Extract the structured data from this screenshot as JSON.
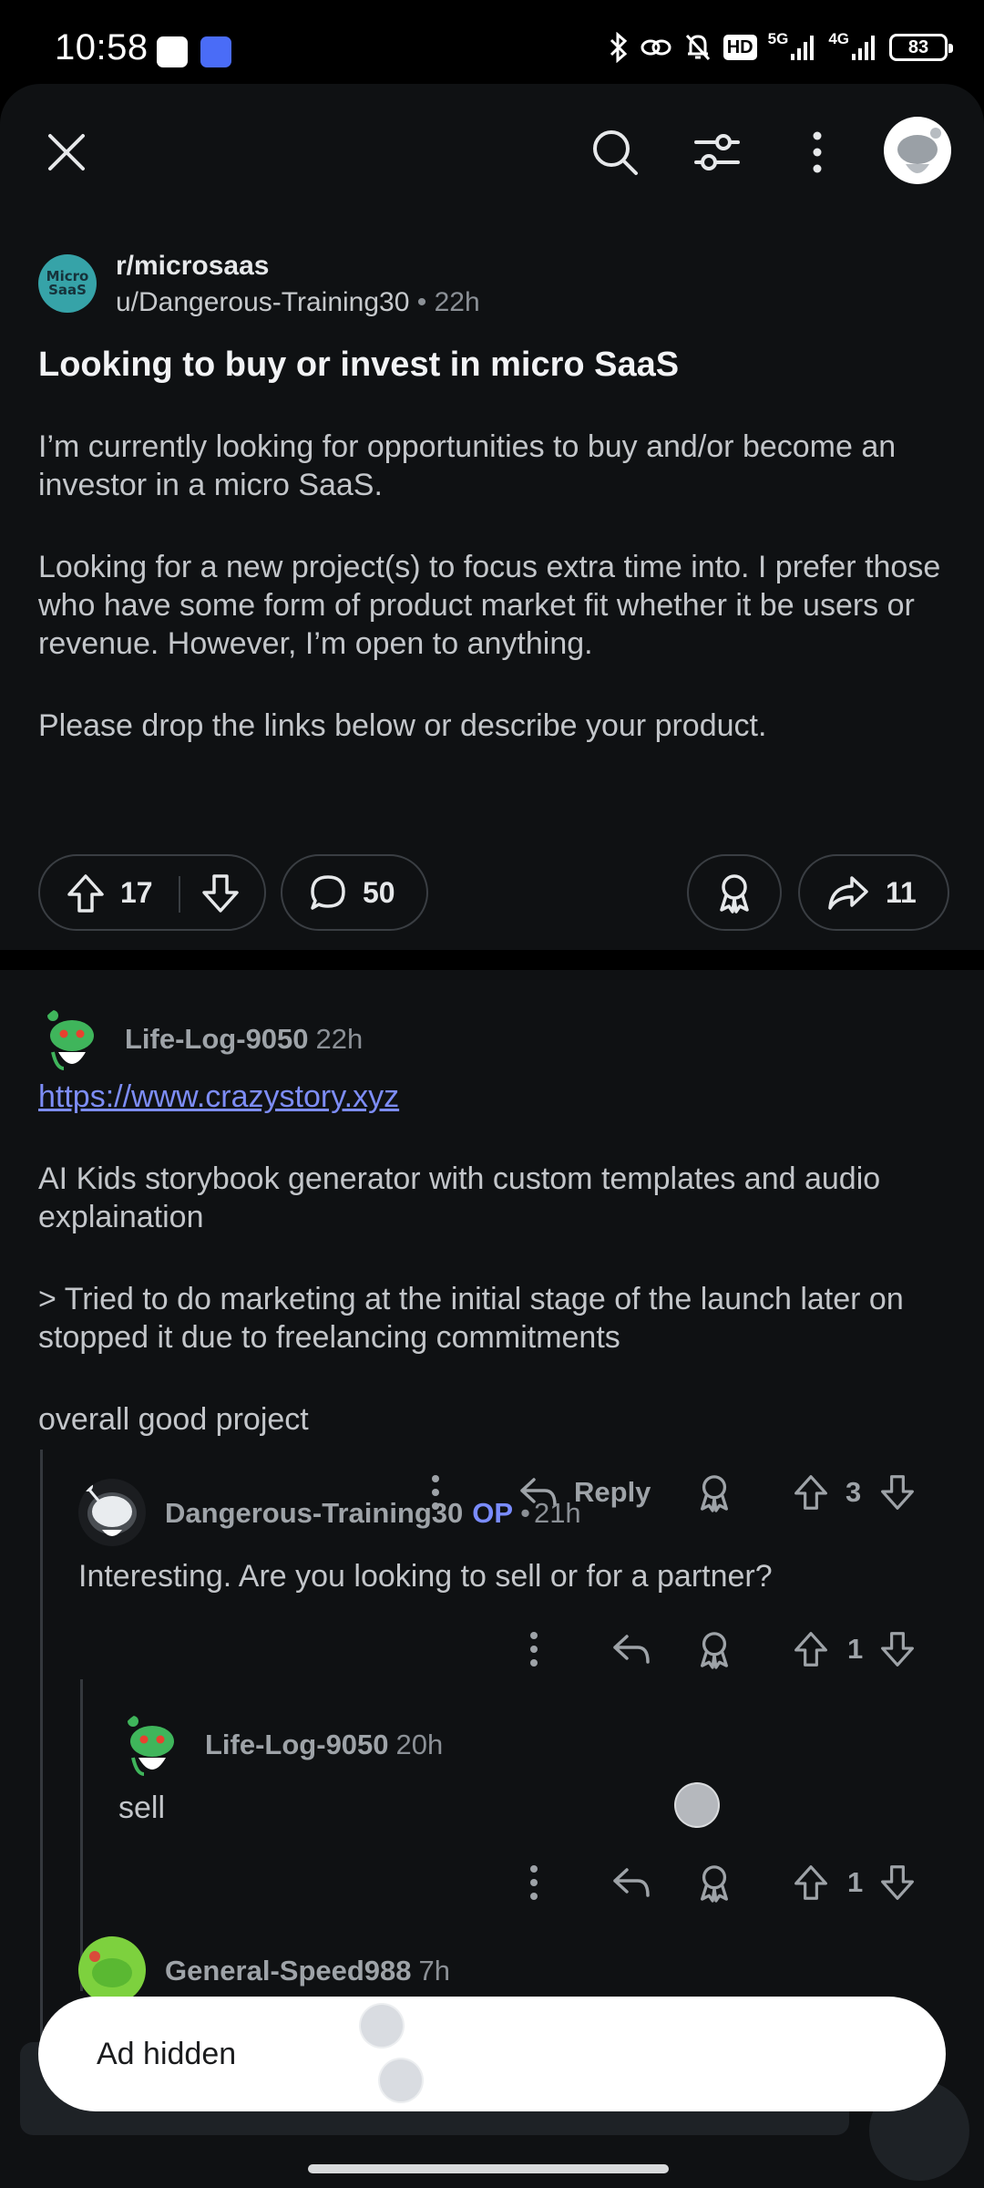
{
  "status_bar": {
    "time": "10:58",
    "hd_badge": "HD",
    "net_5g": "5G",
    "net_4g": "4G",
    "battery": "83"
  },
  "top_bar": {
    "close_icon": "close-icon",
    "search_icon": "search-icon",
    "filter_icon": "sort-filter-icon",
    "more_icon": "more-vertical-icon"
  },
  "post": {
    "subreddit_avatar_text": [
      "Micro",
      "SaaS"
    ],
    "subreddit": "r/microsaas",
    "author": "u/Dangerous-Training30",
    "separator": "•",
    "age": "22h",
    "title": "Looking to buy or invest in micro SaaS",
    "body": [
      "I’m currently looking for opportunities to buy and/or become an investor in a micro SaaS.",
      "Looking for a new project(s) to focus extra time into. I prefer those who have some form of product market fit whether it be users or revenue. However, I’m open to anything.",
      "Please drop the links below or describe your product."
    ],
    "votes": "17",
    "comments": "50",
    "shares": "11"
  },
  "comments": [
    {
      "author": "Life-Log-9050",
      "age": "22h",
      "link": "https://www.crazystory.xyz",
      "body": [
        "AI Kids storybook generator with custom templates and audio explaination",
        "> Tried to do marketing at the initial stage of the launch later on stopped it due to freelancing commitments",
        "overall good project"
      ],
      "reply_label": "Reply",
      "votes": "3"
    },
    {
      "author": "Dangerous-Training30",
      "op": "OP",
      "separator": "•",
      "age": "21h",
      "body": "Interesting. Are you looking to sell or for a partner?",
      "votes": "1"
    },
    {
      "author": "Life-Log-9050",
      "age": "20h",
      "body": "sell",
      "votes": "1"
    },
    {
      "author": "General-Speed988",
      "age": "7h"
    }
  ],
  "toast": {
    "text": "Ad hidden"
  },
  "colors": {
    "background": "#0f1113",
    "link": "#7d8df7",
    "op_badge": "#7a8cff",
    "snoo_green": "#3fb55b"
  }
}
